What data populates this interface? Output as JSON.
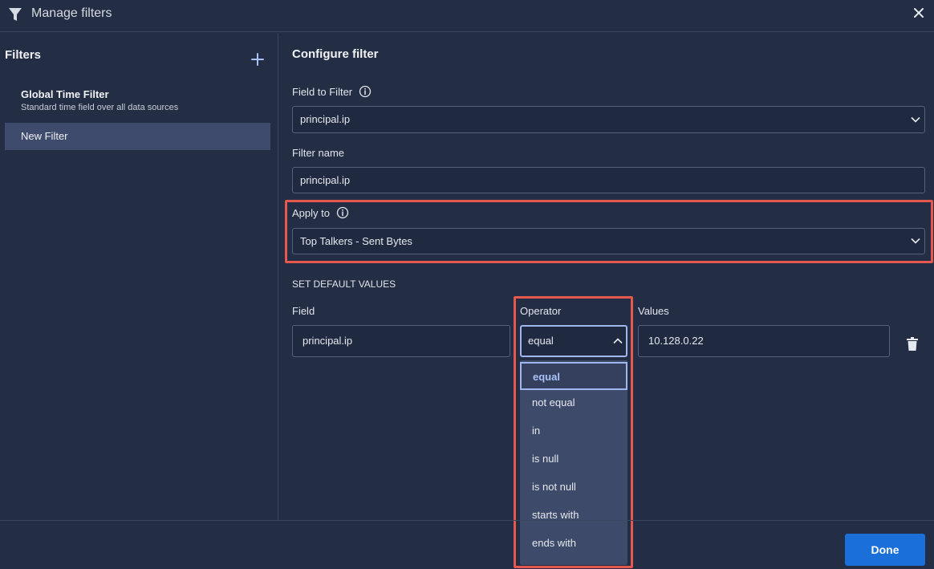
{
  "header": {
    "title": "Manage filters"
  },
  "left": {
    "title": "Filters",
    "items": [
      {
        "title": "Global Time Filter",
        "subtitle": "Standard time field over all data sources"
      },
      {
        "title": "New Filter"
      }
    ]
  },
  "config": {
    "title": "Configure filter",
    "field_to_filter": {
      "label": "Field to Filter",
      "value": "principal.ip"
    },
    "filter_name": {
      "label": "Filter name",
      "value": "principal.ip"
    },
    "apply_to": {
      "label": "Apply to",
      "value": "Top Talkers - Sent Bytes"
    },
    "defaults": {
      "title": "SET DEFAULT VALUES",
      "field_label": "Field",
      "operator_label": "Operator",
      "values_label": "Values",
      "field_value": "principal.ip",
      "operator_value": "equal",
      "values_value": "10.128.0.22"
    },
    "operator_options": [
      "equal",
      "not equal",
      "in",
      "is null",
      "is not null",
      "starts with",
      "ends with"
    ]
  },
  "footer": {
    "done_label": "Done"
  },
  "colors": {
    "background": "#232d44",
    "accent": "#1b6fd8",
    "highlight": "#e6584d",
    "selected_border": "#9fb6ee"
  }
}
